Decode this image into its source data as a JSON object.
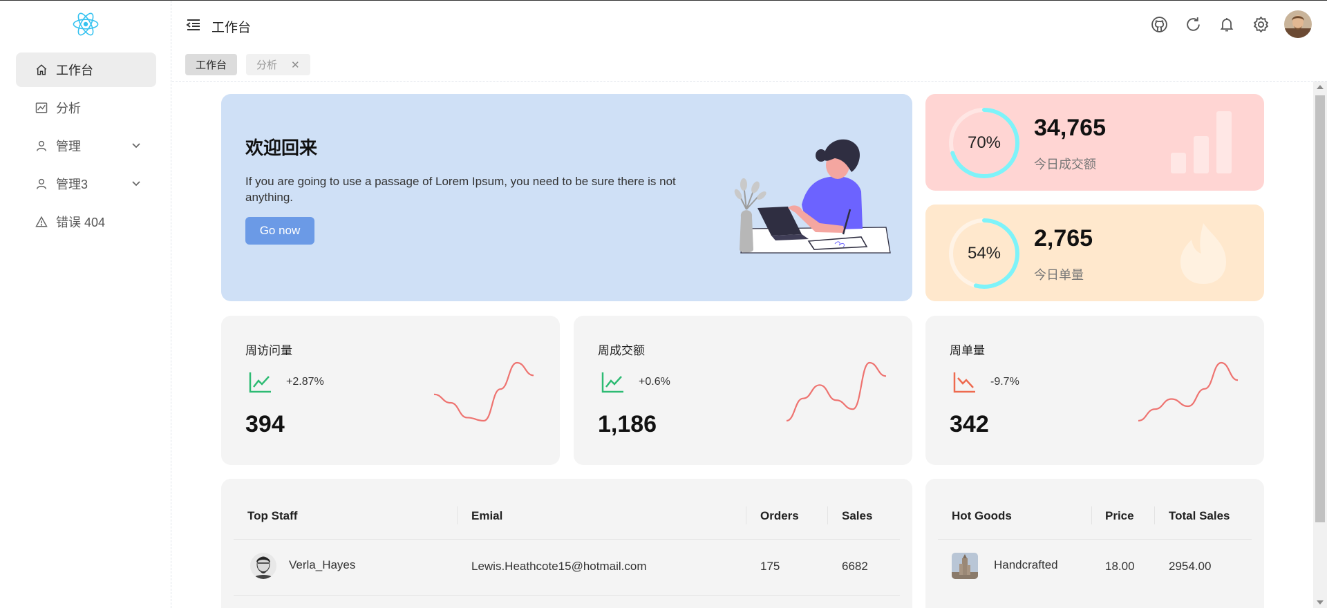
{
  "colors": {
    "accent": "#6b9ae6",
    "ring": "#7ef3f9",
    "sparkline": "#ee7370",
    "trend_up": "#2dbb73",
    "trend_down": "#ee6a4f"
  },
  "sidebar": {
    "logo_icon": "react-logo-icon",
    "items": [
      {
        "label": "工作台",
        "icon": "home-icon",
        "active": true
      },
      {
        "label": "分析",
        "icon": "line-chart-icon"
      },
      {
        "label": "管理",
        "icon": "user-icon",
        "expandable": true
      },
      {
        "label": "管理3",
        "icon": "user-icon",
        "expandable": true
      },
      {
        "label": "错误 404",
        "icon": "warning-icon"
      }
    ]
  },
  "header": {
    "toggle_icon": "menu-fold-icon",
    "title": "工作台",
    "icons": [
      "github-icon",
      "refresh-icon",
      "bell-icon",
      "gear-icon"
    ],
    "avatar": "user-avatar"
  },
  "tabs": [
    {
      "label": "工作台",
      "active": true
    },
    {
      "label": "分析",
      "closable": true,
      "close": "✕"
    }
  ],
  "welcome": {
    "title": "欢迎回来",
    "description": "If you are going to use a passage of Lorem Ipsum, you need to be sure there is not anything.",
    "button": "Go now"
  },
  "stats": [
    {
      "percent": "70%",
      "percent_value": 70,
      "value": "34,765",
      "label": "今日成交额",
      "deco_icon": "bar-chart-icon"
    },
    {
      "percent": "54%",
      "percent_value": 54,
      "value": "2,765",
      "label": "今日单量",
      "deco_icon": "flame-icon"
    }
  ],
  "weekly": [
    {
      "title": "周访问量",
      "change": "+2.87%",
      "trend": "up",
      "value": "394",
      "spark": [
        30,
        22,
        8,
        5,
        35,
        60,
        48
      ]
    },
    {
      "title": "周成交额",
      "change": "+0.6%",
      "trend": "up",
      "value": "1,186",
      "spark": [
        5,
        30,
        45,
        28,
        18,
        70,
        55
      ]
    },
    {
      "title": "周单量",
      "change": "-9.7%",
      "trend": "down",
      "value": "342",
      "spark": [
        10,
        18,
        25,
        20,
        32,
        50,
        38
      ]
    }
  ],
  "staff_table": {
    "headers": [
      "Top Staff",
      "Emial",
      "Orders",
      "Sales"
    ],
    "rows": [
      {
        "name": "Verla_Hayes",
        "email": "Lewis.Heathcote15@hotmail.com",
        "orders": "175",
        "sales": "6682"
      }
    ]
  },
  "goods_table": {
    "headers": [
      "Hot Goods",
      "Price",
      "Total Sales"
    ],
    "rows": [
      {
        "name": "Handcrafted",
        "price": "18.00",
        "total": "2954.00"
      }
    ]
  }
}
